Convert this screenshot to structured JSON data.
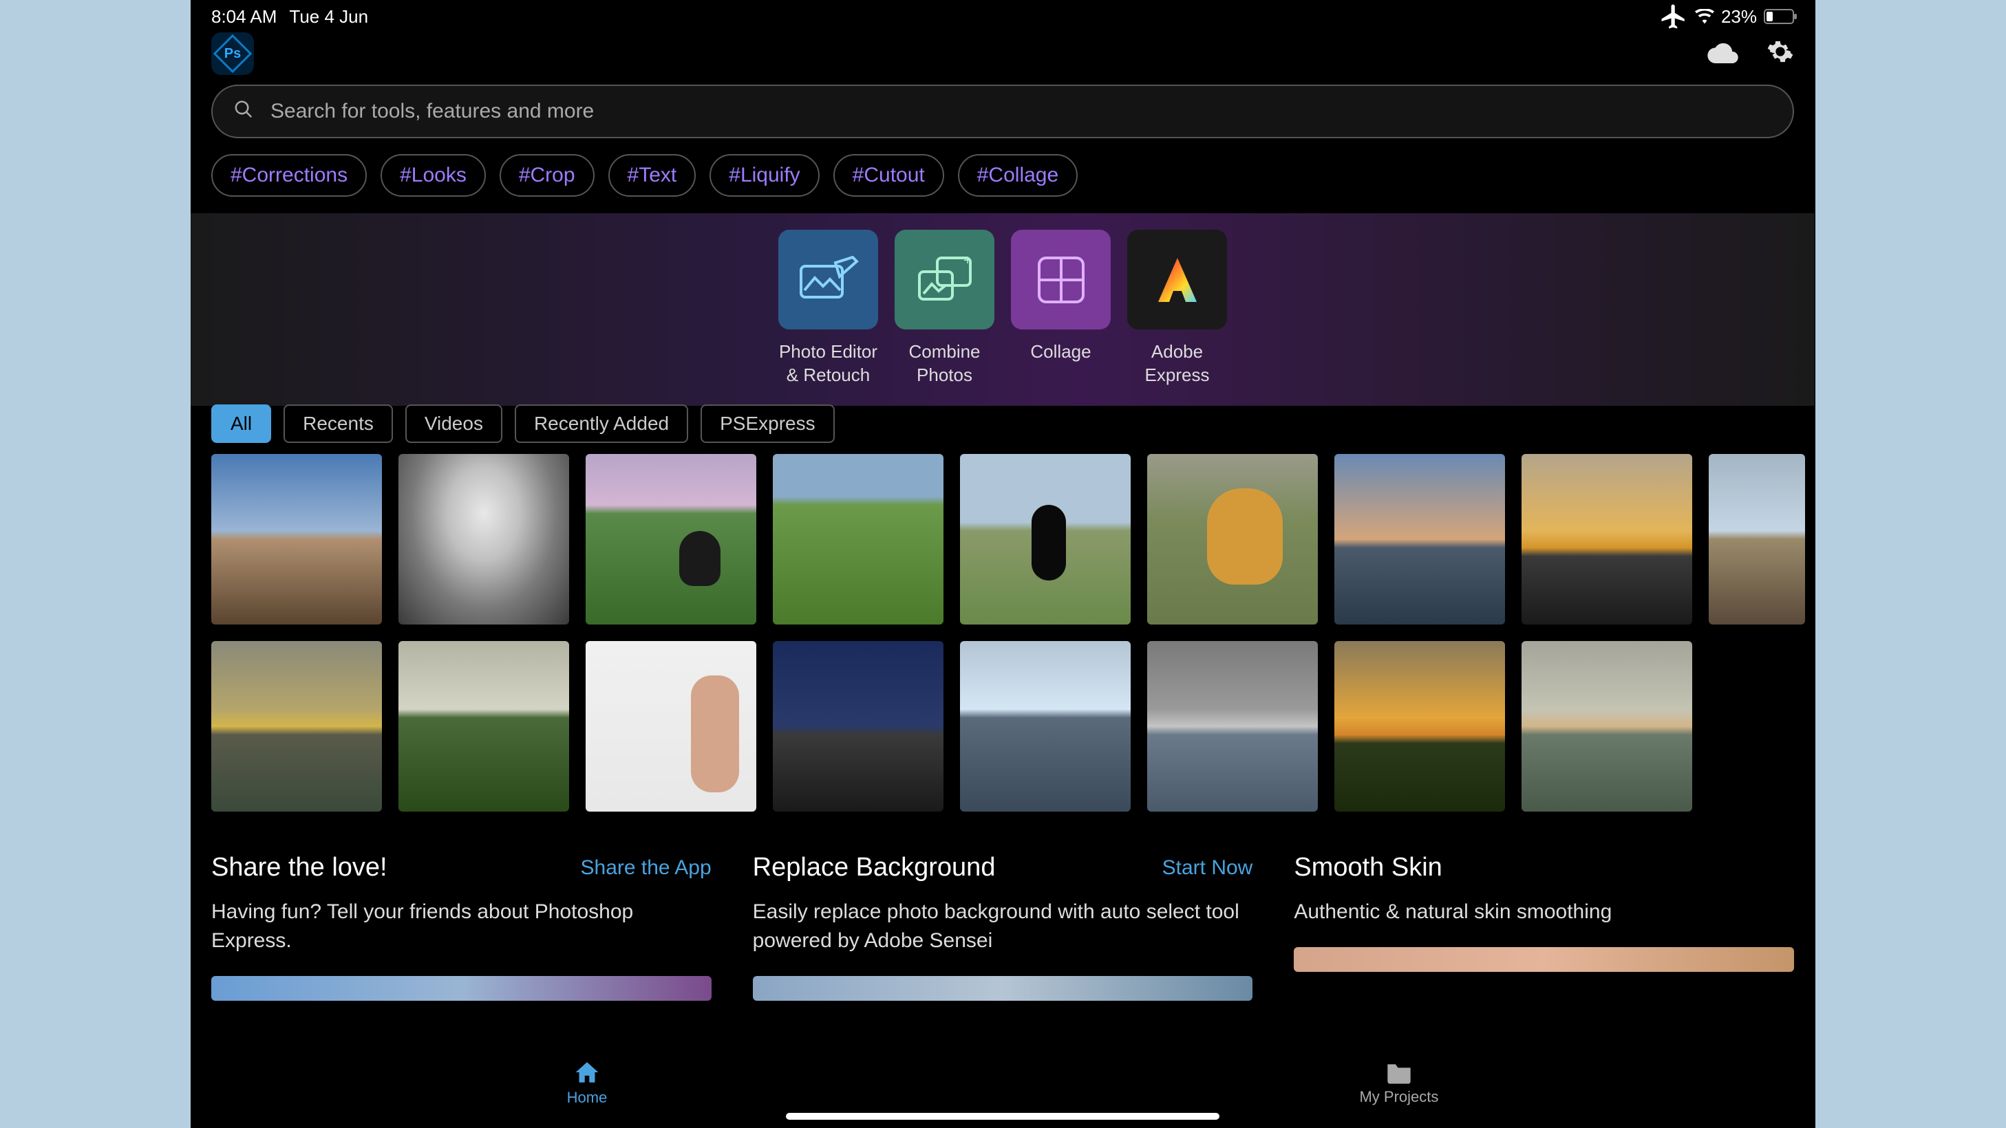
{
  "status": {
    "time": "8:04 AM",
    "date": "Tue 4 Jun",
    "battery_pct": "23%"
  },
  "search": {
    "placeholder": "Search for tools, features and more"
  },
  "tags": [
    "#Corrections",
    "#Looks",
    "#Crop",
    "#Text",
    "#Liquify",
    "#Cutout",
    "#Collage"
  ],
  "tools": [
    {
      "label1": "Photo Editor",
      "label2": "& Retouch"
    },
    {
      "label1": "Combine",
      "label2": "Photos"
    },
    {
      "label1": "Collage",
      "label2": ""
    },
    {
      "label1": "Adobe",
      "label2": "Express"
    }
  ],
  "filters": [
    "All",
    "Recents",
    "Videos",
    "Recently Added",
    "PSExpress"
  ],
  "cards": {
    "share": {
      "title": "Share the love!",
      "link": "Share the App",
      "desc": "Having fun? Tell your friends about Photoshop Express."
    },
    "replace": {
      "title": "Replace Background",
      "link": "Start Now",
      "desc": "Easily replace photo background with auto select tool powered by Adobe Sensei"
    },
    "smooth": {
      "title": "Smooth Skin",
      "link": "",
      "desc": "Authentic & natural skin smoothing"
    }
  },
  "nav": {
    "home": "Home",
    "projects": "My Projects"
  }
}
